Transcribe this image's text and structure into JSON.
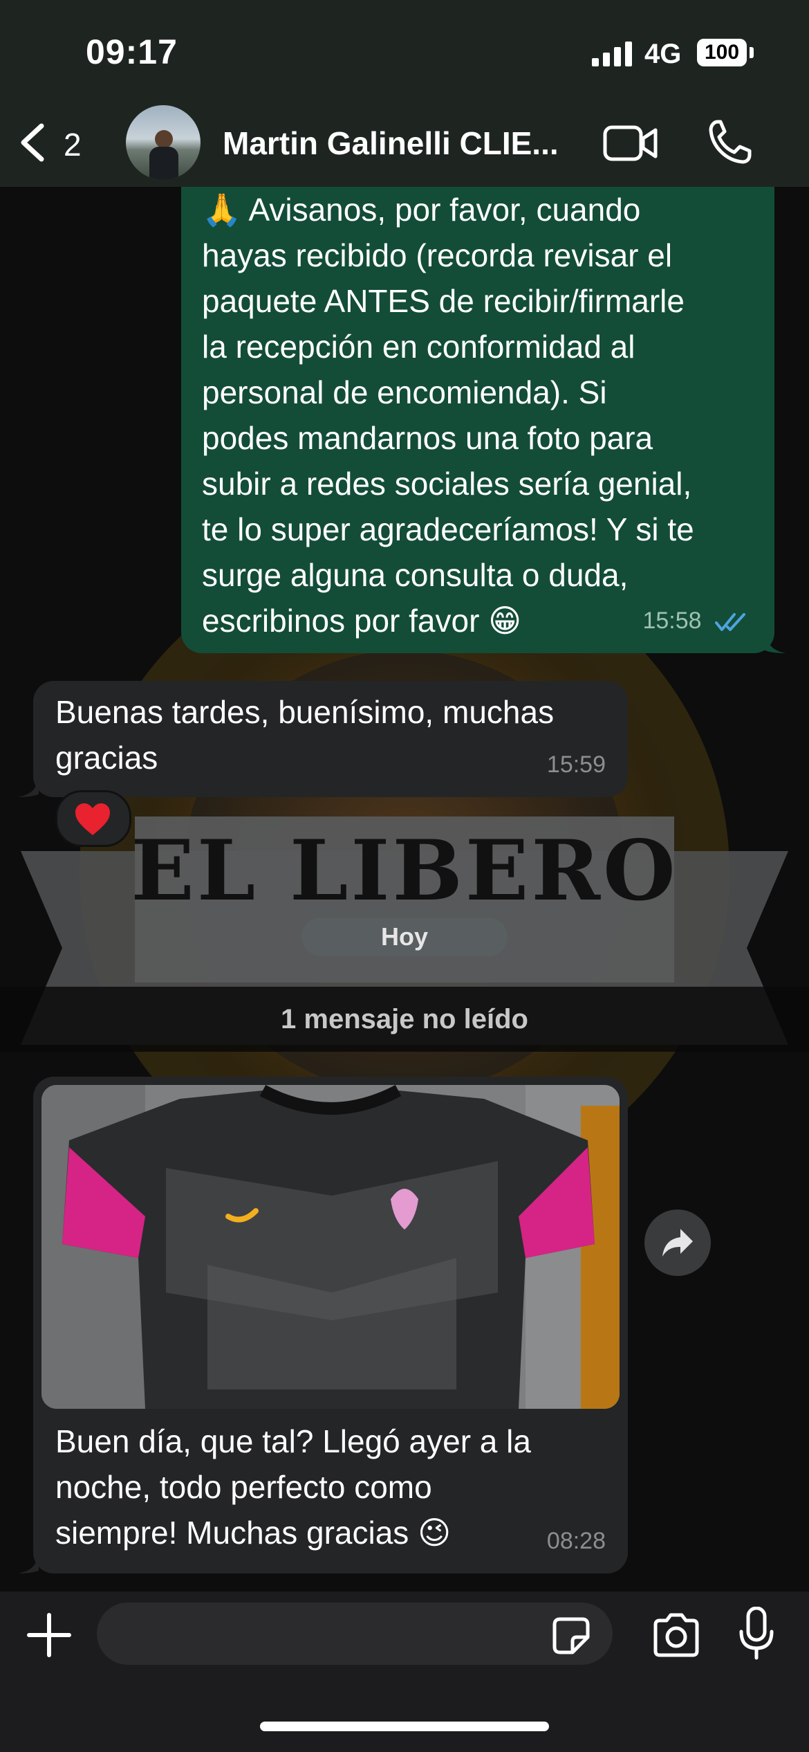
{
  "status_bar": {
    "time": "09:17",
    "network": "4G",
    "battery": "100"
  },
  "header": {
    "back_count": "2",
    "contact_name": "Martin Galinelli CLIE..."
  },
  "wallpaper": {
    "brand_text": "EL LIBERO"
  },
  "messages": [
    {
      "direction": "outgoing",
      "text": "🙏 Avisanos, por favor, cuando\nhayas recibido (recorda revisar el\npaquete ANTES de recibir/firmarle\nla recepción en conformidad al\npersonal de encomienda). Si\npodes mandarnos una foto para\nsubir a redes sociales sería genial,\nte lo super agradeceríamos! Y si te\nsurge alguna consulta o duda,\nescribinos por favor 😁",
      "time": "15:58",
      "status": "read"
    },
    {
      "direction": "incoming",
      "text": "Buenas tardes, buenísimo, muchas\ngracias",
      "time": "15:59",
      "reaction": "❤️"
    },
    {
      "direction": "incoming",
      "has_photo": true,
      "text": "Buen día, que tal? Llegó ayer a la\nnoche, todo perfecto como\nsiempre! Muchas gracias 😉",
      "time": "08:28"
    }
  ],
  "day_separator": "Hoy",
  "unread_banner": "1 mensaje no leído",
  "composer": {
    "placeholder": ""
  },
  "colors": {
    "outgoing": "#134d37",
    "incoming": "#242526",
    "read_ticks": "#4fa3e0"
  }
}
